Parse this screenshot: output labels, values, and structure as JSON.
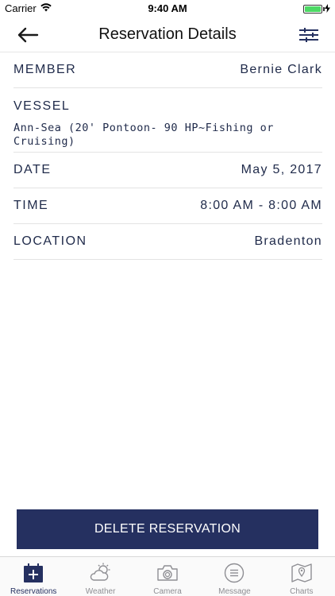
{
  "status_bar": {
    "carrier": "Carrier",
    "time": "9:40 AM"
  },
  "nav": {
    "title": "Reservation Details",
    "back_icon": "arrow-left-icon",
    "filter_icon": "sliders-icon"
  },
  "details": {
    "member": {
      "label": "MEMBER",
      "value": "Bernie Clark"
    },
    "vessel": {
      "label": "VESSEL",
      "value": "Ann-Sea (20' Pontoon- 90 HP~Fishing or Cruising)"
    },
    "date": {
      "label": "DATE",
      "value": "May 5, 2017"
    },
    "time": {
      "label": "TIME",
      "value": "8:00 AM - 8:00 AM"
    },
    "location": {
      "label": "LOCATION",
      "value": "Bradenton"
    }
  },
  "actions": {
    "delete_label": "DELETE RESERVATION"
  },
  "tabs": [
    {
      "label": "Reservations",
      "icon": "calendar-plus-icon",
      "active": true
    },
    {
      "label": "Weather",
      "icon": "weather-icon",
      "active": false
    },
    {
      "label": "Camera",
      "icon": "camera-icon",
      "active": false
    },
    {
      "label": "Message",
      "icon": "message-icon",
      "active": false
    },
    {
      "label": "Charts",
      "icon": "map-icon",
      "active": false
    }
  ],
  "colors": {
    "primary": "#253060",
    "text": "#1f2a4a",
    "battery": "#4cd964",
    "tab_inactive": "#8e8e93"
  }
}
